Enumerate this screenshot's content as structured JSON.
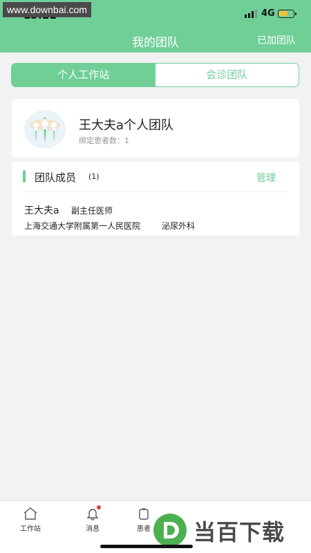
{
  "watermark": "www.downbai.com",
  "status": {
    "time": "13:21",
    "network": "4G"
  },
  "header": {
    "title": "我的团队",
    "action": "已加团队"
  },
  "tabs": [
    {
      "label": "个人工作站",
      "active": true
    },
    {
      "label": "会诊团队",
      "active": false
    }
  ],
  "team": {
    "name": "王大夫a个人团队",
    "patients_label": "绑定患者数：",
    "patients_count": "1"
  },
  "members": {
    "title": "团队成员",
    "count": "(1)",
    "manage_label": "管理",
    "list": [
      {
        "name": "王大夫a",
        "title": "副主任医师",
        "hospital": "上海交通大学附属第一人民医院",
        "dept": "泌尿外科"
      }
    ]
  },
  "nav": [
    {
      "label": "工作站",
      "icon": "home-icon"
    },
    {
      "label": "消息",
      "icon": "bell-icon",
      "badge": true
    },
    {
      "label": "患者",
      "icon": "patient-icon"
    }
  ],
  "brand": {
    "text": "当百下载"
  },
  "colors": {
    "primary": "#6fcf97",
    "badge": "#e53935"
  }
}
